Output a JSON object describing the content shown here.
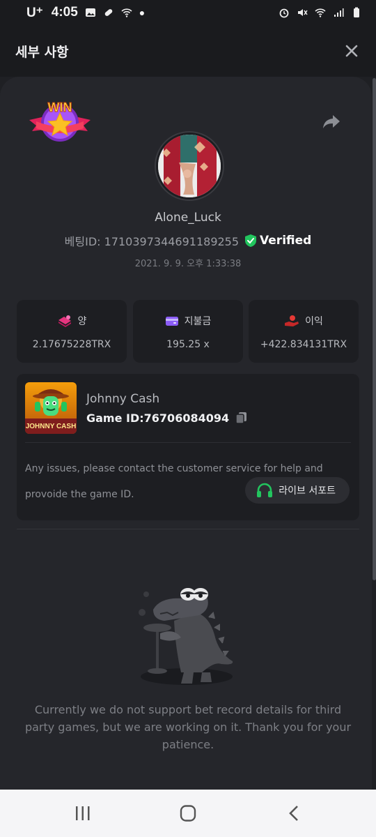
{
  "status_bar": {
    "carrier": "U⁺",
    "time": "4:05"
  },
  "header": {
    "title": "세부 사항",
    "close_icon": "close-icon"
  },
  "bet": {
    "badge": "WIN",
    "username": "Alone_Luck",
    "bet_id": "베팅ID: 1710397344691189255",
    "verified_label": "Verified",
    "datetime": "2021. 9. 9. 오후 1:33:38"
  },
  "stats": [
    {
      "label": "양",
      "value": "2.17675228TRX",
      "icon": "amount-icon",
      "color": "#e6357f"
    },
    {
      "label": "지불금",
      "value": "195.25 x",
      "icon": "wallet-icon",
      "color": "#8b5cf6"
    },
    {
      "label": "이익",
      "value": "+422.834131TRX",
      "icon": "profit-hand-icon",
      "color": "#e53935"
    }
  ],
  "game": {
    "name": "Johnny Cash",
    "game_id": "Game ID:76706084094",
    "note": "Any issues, please contact the customer service for help and provoide the game ID.",
    "support_label": "라이브 서포트"
  },
  "notice": "Currently we do not support bet record details for third party games, but we are working on it. Thank you for your patience.",
  "colors": {
    "background": "#1f2024",
    "card": "#25262b",
    "accent_green": "#22c55e",
    "verified_green": "#22c55e"
  }
}
